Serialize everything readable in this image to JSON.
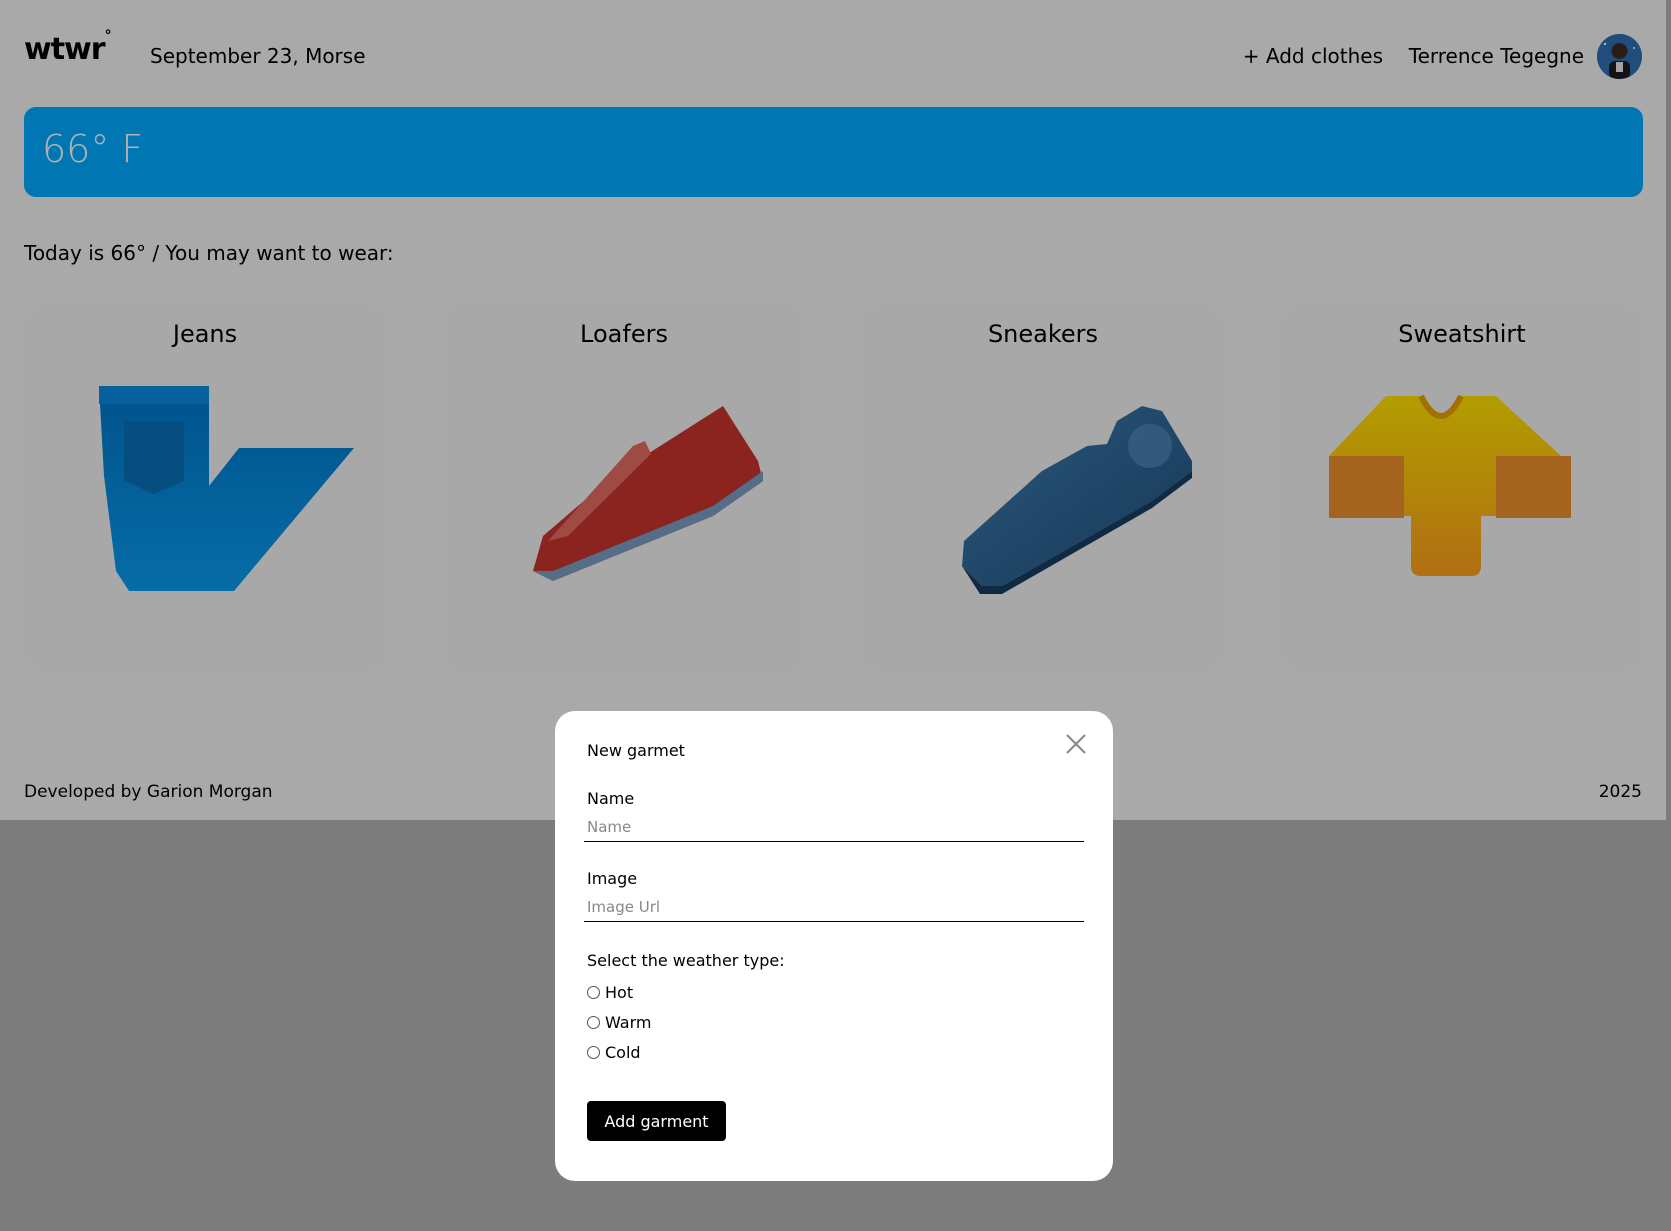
{
  "header": {
    "logo": "wtwr",
    "logo_mark": "°",
    "date_location": "September 23, Morse",
    "add_clothes_label": "+ Add clothes",
    "username": "Terrence Tegegne"
  },
  "weather": {
    "temperature": "66° F"
  },
  "recommendation": {
    "text": "Today is 66° / You may want to wear:"
  },
  "cards": [
    {
      "name": "Jeans",
      "icon": "jeans-icon"
    },
    {
      "name": "Loafers",
      "icon": "loafer-icon"
    },
    {
      "name": "Sneakers",
      "icon": "sneaker-icon"
    },
    {
      "name": "Sweatshirt",
      "icon": "sweatshirt-icon"
    }
  ],
  "footer": {
    "credit": "Developed by Garion Morgan",
    "year": "2025"
  },
  "modal": {
    "title": "New garmet",
    "name_label": "Name",
    "name_placeholder": "Name",
    "name_value": "",
    "image_label": "Image",
    "image_placeholder": "Image Url",
    "image_value": "",
    "weather_label": "Select the weather type:",
    "options": [
      "Hot",
      "Warm",
      "Cold"
    ],
    "submit_label": "Add garment"
  },
  "colors": {
    "accent": "#00aaff",
    "background": "#f3f3f3",
    "card": "#f1f1f1",
    "modal": "#ffffff",
    "button": "#000000"
  }
}
